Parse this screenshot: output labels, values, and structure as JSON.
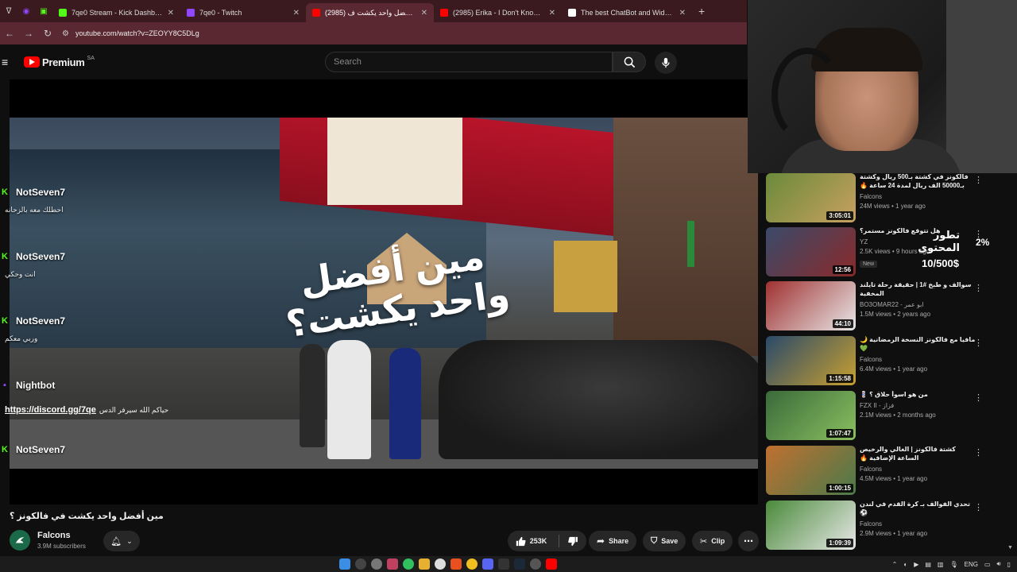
{
  "browser": {
    "tabs": [
      {
        "label": "7qe0 Stream - Kick Dashboard",
        "color": "#53fc18",
        "active": false
      },
      {
        "label": "7qe0 - Twitch",
        "color": "#9146ff",
        "active": false
      },
      {
        "label": "(2985) مين أفضل واحد يكشت ف...",
        "color": "#ff0000",
        "active": true
      },
      {
        "label": "(2985) Erika - I Don't Know [Offi...",
        "color": "#ff0000",
        "active": false
      },
      {
        "label": "The best ChatBot and Widgets",
        "color": "#ffffff",
        "active": false
      }
    ],
    "url": "youtube.com/watch?v=ZEOYY8C5DLg"
  },
  "youtube": {
    "logo_text": "Premium",
    "country": "SA",
    "search_placeholder": "Search"
  },
  "video": {
    "overlay_title": "مين أفضل واحد يكشت؟",
    "title": "مين أفضل واحد يكشت في فالكونز ؟",
    "channel": "Falcons",
    "subscribers": "3.9M subscribers",
    "likes": "253K",
    "share_label": "Share",
    "save_label": "Save",
    "clip_label": "Clip"
  },
  "chat": [
    {
      "user": "NotSeven7",
      "platform": "kick",
      "text": "احطلك معه بالزحانه"
    },
    {
      "user": "NotSeven7",
      "platform": "kick",
      "text": "انت وحكي"
    },
    {
      "user": "NotSeven7",
      "platform": "kick",
      "text": "وربي معكم"
    },
    {
      "user": "Nightbot",
      "platform": "twitch",
      "link": "https://discord.gg/7qe",
      "text": "حياكم الله سيرفر الدس"
    },
    {
      "user": "NotSeven7",
      "platform": "kick",
      "text": ""
    }
  ],
  "goal": {
    "title": "تطور المحتوى",
    "amount": "10/500$",
    "percent": "2%"
  },
  "recommendations": [
    {
      "title": "فالكونز في كشتة بـ500 ريال وكشتة بـ50000 الف ريال لمدة 24 ساعة 🔥",
      "channel": "Falcons",
      "views": "24M views • 1 year ago",
      "duration": "3:05:01",
      "colors": [
        "#6a8a3a",
        "#c8a060"
      ]
    },
    {
      "title": "هل تتوقع فالكونز مستمر؟",
      "channel": "YZ",
      "views": "2.5K views • 9 hours ago",
      "duration": "12:56",
      "new": "New",
      "colors": [
        "#3a4a6a",
        "#8a2a2a"
      ]
    },
    {
      "title": "سوالف و طبخ #1 | حقيقة رحلة تايلند المخفية",
      "channel": "BO3OMAR22 - ابو عمر",
      "views": "1.5M views • 2 years ago",
      "duration": "44:10",
      "colors": [
        "#a03030",
        "#e8e8e8"
      ]
    },
    {
      "title": "مافيا مع فالكونز النسخة الرمضانية 🌙 💚",
      "channel": "Falcons",
      "views": "6.4M views • 1 year ago",
      "duration": "1:15:58",
      "colors": [
        "#2a4a6a",
        "#c8a030"
      ]
    },
    {
      "title": "من هو اسوأ حلاق ؟ 💈",
      "channel": "FZX II - فزاز",
      "views": "2.1M views • 2 months ago",
      "duration": "1:07:47",
      "colors": [
        "#3a6a3a",
        "#8ac060"
      ]
    },
    {
      "title": "كشتة فالكونز | الغالي والرخيص الساعة الإضافية 🔥",
      "channel": "Falcons",
      "views": "4.5M views • 1 year ago",
      "duration": "1:00:15",
      "colors": [
        "#c07030",
        "#4a7a4a"
      ]
    },
    {
      "title": "تحدي الفوالف بـ كرة القدم في لندن ⚽",
      "channel": "Falcons",
      "views": "2.9M views • 1 year ago",
      "duration": "1:09:39",
      "colors": [
        "#4a8a3a",
        "#e8e8e8"
      ]
    }
  ],
  "taskbar": {
    "lang": "ENG"
  }
}
